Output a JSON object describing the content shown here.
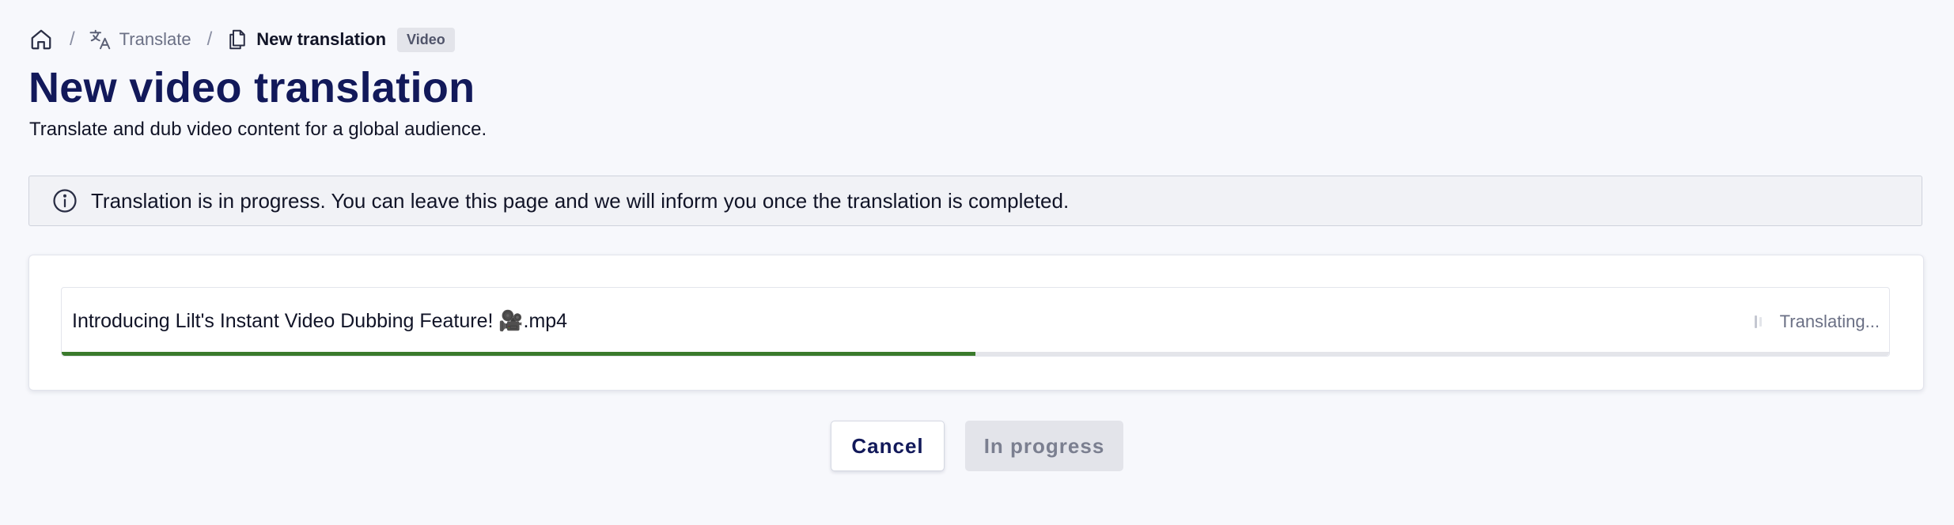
{
  "breadcrumb": {
    "items": [
      {
        "icon": "home-icon"
      },
      {
        "icon": "translate-icon",
        "label": "Translate"
      },
      {
        "icon": "document-copy-icon",
        "label": "New translation",
        "badge": "Video"
      }
    ],
    "separator": "/"
  },
  "header": {
    "title": "New video translation",
    "subtitle": "Translate and dub video content for a global audience."
  },
  "info_banner": {
    "icon": "info-icon",
    "text": "Translation is in progress. You can leave this page and we will inform you once the translation is completed."
  },
  "upload": {
    "file_name": "Introducing Lilt's Instant Video Dubbing Feature! 🎥.mp4",
    "status": "Translating...",
    "status_icon": "spinner-icon",
    "progress": 0.5,
    "progress_color": "#3a7a2c"
  },
  "actions": {
    "cancel_label": "Cancel",
    "progress_label": "In progress"
  },
  "colors": {
    "title": "#12195a",
    "background": "#f7f8fc",
    "progress_track": "#e4e5ea"
  }
}
